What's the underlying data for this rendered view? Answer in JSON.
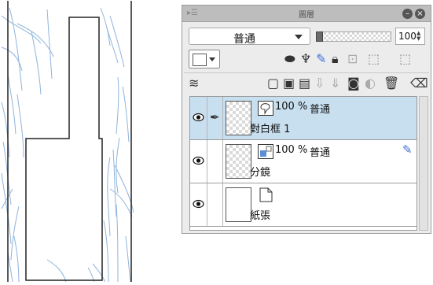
{
  "panel": {
    "title": "圖層",
    "blend_mode": "普通",
    "opacity": "100"
  },
  "layers": [
    {
      "name": "對白框 1",
      "opacity": "100 %",
      "mode": "普通",
      "selected": true
    },
    {
      "name": "分鏡",
      "opacity": "100 %",
      "mode": "普通",
      "selected": false
    },
    {
      "name": "紙張",
      "opacity": "",
      "mode": "",
      "selected": false
    }
  ],
  "colors": {
    "selected_row": "#c8dff0",
    "sketch_line": "#8fb4dc"
  }
}
